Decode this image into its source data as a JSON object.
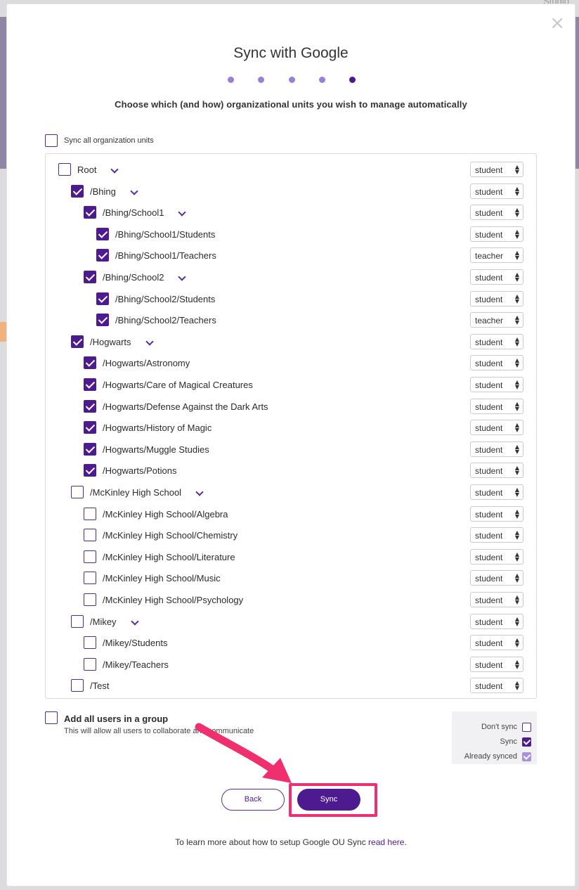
{
  "modal": {
    "title": "Sync with Google",
    "subtitle": "Choose which (and how) organizational units you wish to manage automatically",
    "steps": 5,
    "active_step": 5,
    "close_icon": "close-icon"
  },
  "sync_all": {
    "label": "Sync all organization units",
    "checked": false
  },
  "units": [
    {
      "path": "Root",
      "level": 0,
      "checked": false,
      "expandable": true,
      "role": "student"
    },
    {
      "path": "/Bhing",
      "level": 1,
      "checked": true,
      "expandable": true,
      "role": "student"
    },
    {
      "path": "/Bhing/School1",
      "level": 2,
      "checked": true,
      "expandable": true,
      "role": "student"
    },
    {
      "path": "/Bhing/School1/Students",
      "level": 3,
      "checked": true,
      "expandable": false,
      "role": "student"
    },
    {
      "path": "/Bhing/School1/Teachers",
      "level": 3,
      "checked": true,
      "expandable": false,
      "role": "teacher"
    },
    {
      "path": "/Bhing/School2",
      "level": 2,
      "checked": true,
      "expandable": true,
      "role": "student"
    },
    {
      "path": "/Bhing/School2/Students",
      "level": 3,
      "checked": true,
      "expandable": false,
      "role": "student"
    },
    {
      "path": "/Bhing/School2/Teachers",
      "level": 3,
      "checked": true,
      "expandable": false,
      "role": "teacher"
    },
    {
      "path": "/Hogwarts",
      "level": 1,
      "checked": true,
      "expandable": true,
      "role": "student"
    },
    {
      "path": "/Hogwarts/Astronomy",
      "level": 2,
      "checked": true,
      "expandable": false,
      "role": "student"
    },
    {
      "path": "/Hogwarts/Care of Magical Creatures",
      "level": 2,
      "checked": true,
      "expandable": false,
      "role": "student"
    },
    {
      "path": "/Hogwarts/Defense Against the Dark Arts",
      "level": 2,
      "checked": true,
      "expandable": false,
      "role": "student"
    },
    {
      "path": "/Hogwarts/History of Magic",
      "level": 2,
      "checked": true,
      "expandable": false,
      "role": "student"
    },
    {
      "path": "/Hogwarts/Muggle Studies",
      "level": 2,
      "checked": true,
      "expandable": false,
      "role": "student"
    },
    {
      "path": "/Hogwarts/Potions",
      "level": 2,
      "checked": true,
      "expandable": false,
      "role": "student"
    },
    {
      "path": "/McKinley High School",
      "level": 1,
      "checked": false,
      "expandable": true,
      "role": "student"
    },
    {
      "path": "/McKinley High School/Algebra",
      "level": 2,
      "checked": false,
      "expandable": false,
      "role": "student"
    },
    {
      "path": "/McKinley High School/Chemistry",
      "level": 2,
      "checked": false,
      "expandable": false,
      "role": "student"
    },
    {
      "path": "/McKinley High School/Literature",
      "level": 2,
      "checked": false,
      "expandable": false,
      "role": "student"
    },
    {
      "path": "/McKinley High School/Music",
      "level": 2,
      "checked": false,
      "expandable": false,
      "role": "student"
    },
    {
      "path": "/McKinley High School/Psychology",
      "level": 2,
      "checked": false,
      "expandable": false,
      "role": "student"
    },
    {
      "path": "/Mikey",
      "level": 1,
      "checked": false,
      "expandable": true,
      "role": "student"
    },
    {
      "path": "/Mikey/Students",
      "level": 2,
      "checked": false,
      "expandable": false,
      "role": "student"
    },
    {
      "path": "/Mikey/Teachers",
      "level": 2,
      "checked": false,
      "expandable": false,
      "role": "student"
    },
    {
      "path": "/Test",
      "level": 1,
      "checked": false,
      "expandable": false,
      "role": "student"
    }
  ],
  "group": {
    "title": "Add all users in a group",
    "subtitle": "This will allow all users to collaborate and communicate",
    "checked": false
  },
  "legend": {
    "dont_sync": "Don't sync",
    "sync": "Sync",
    "already_synced": "Already synced"
  },
  "buttons": {
    "back": "Back",
    "sync": "Sync"
  },
  "footer": {
    "text": "To learn more about how to setup Google OU Sync ",
    "link": "read here",
    "suffix": "."
  },
  "background": {
    "top_right_text": "Studio"
  },
  "colors": {
    "accent": "#4e1a8f",
    "annotation": "#f0306e",
    "step": "#9b7fd4"
  }
}
